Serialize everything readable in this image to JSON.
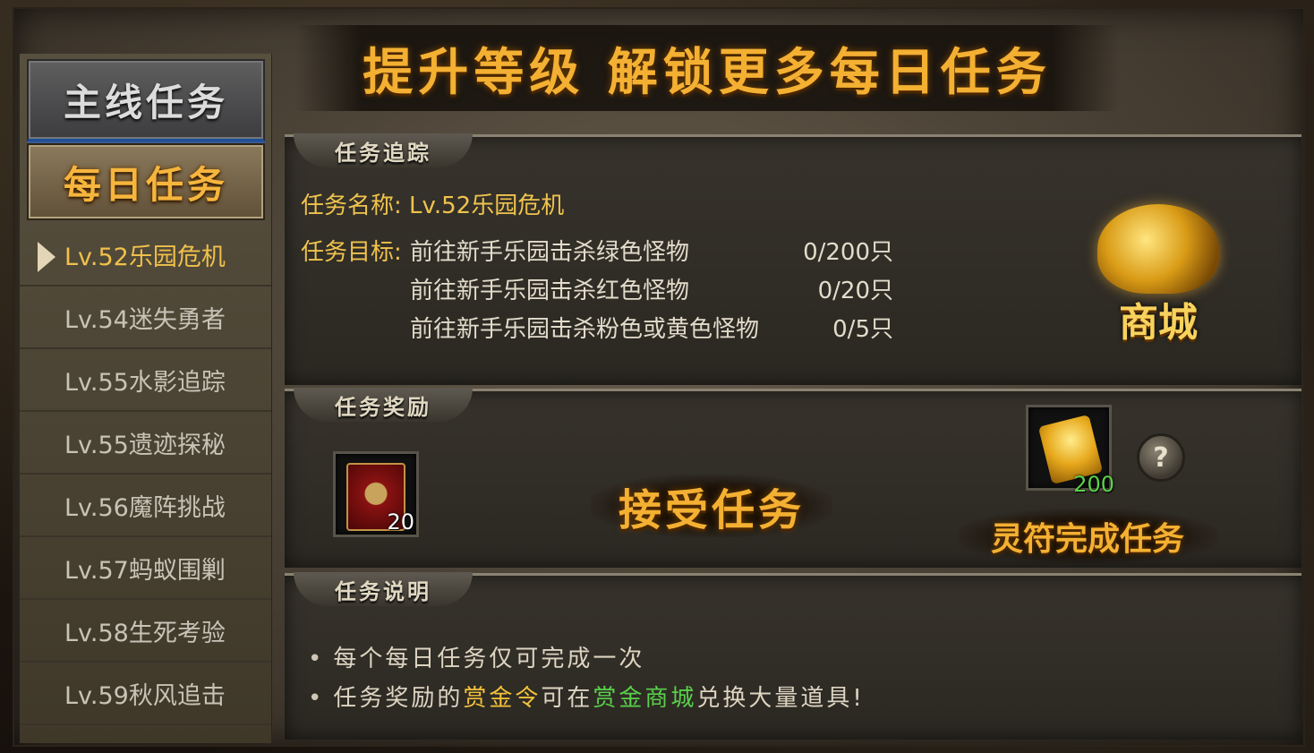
{
  "banner": {
    "title": "提升等级 解锁更多每日任务"
  },
  "sidebar": {
    "main_tab": "主线任务",
    "daily_tab": "每日任务",
    "quests": [
      {
        "label": "Lv.52乐园危机",
        "active": true
      },
      {
        "label": "Lv.54迷失勇者",
        "active": false
      },
      {
        "label": "Lv.55水影追踪",
        "active": false
      },
      {
        "label": "Lv.55遗迹探秘",
        "active": false
      },
      {
        "label": "Lv.56魔阵挑战",
        "active": false
      },
      {
        "label": "Lv.57蚂蚁围剿",
        "active": false
      },
      {
        "label": "Lv.58生死考验",
        "active": false
      },
      {
        "label": "Lv.59秋风追击",
        "active": false
      }
    ]
  },
  "tracking": {
    "section_label": "任务追踪",
    "name_line": "任务名称: Lv.52乐园危机",
    "target_label": "任务目标:",
    "objectives": [
      {
        "text": "前往新手乐园击杀绿色怪物",
        "count": "0/200只"
      },
      {
        "text": "前往新手乐园击杀红色怪物",
        "count": "0/20只"
      },
      {
        "text": "前往新手乐园击杀粉色或黄色怪物",
        "count": "0/5只"
      }
    ],
    "shop_label": "商城"
  },
  "reward": {
    "section_label": "任务奖励",
    "item_count": "20",
    "talisman_count": "200",
    "accept_label": "接受任务",
    "talisman_label": "灵符完成任务",
    "help_label": "?"
  },
  "description": {
    "section_label": "任务说明",
    "line1": "每个每日任务仅可完成一次",
    "line2_a": "任务奖励的",
    "line2_b": "赏金令",
    "line2_c": "可在",
    "line2_d": "赏金商城",
    "line2_e": "兑换大量道具!",
    "bullet": "•"
  }
}
